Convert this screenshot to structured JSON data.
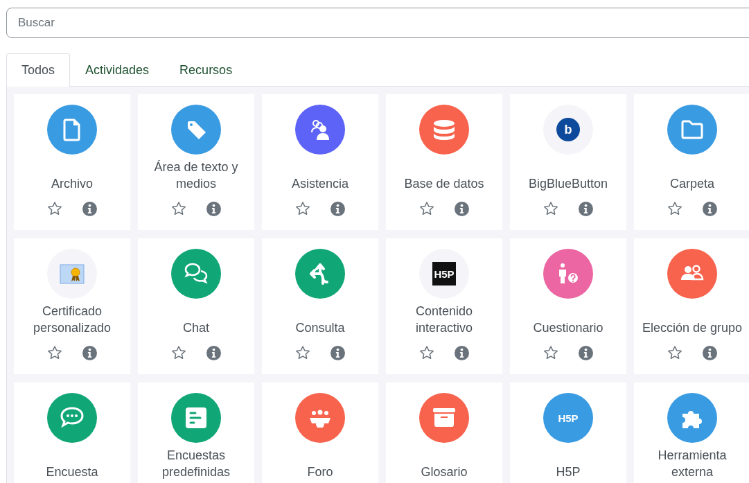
{
  "search": {
    "placeholder": "Buscar"
  },
  "tabs": [
    {
      "label": "Todos",
      "selected": true
    },
    {
      "label": "Actividades",
      "selected": false
    },
    {
      "label": "Recursos",
      "selected": false
    }
  ],
  "modules": [
    {
      "name": "Archivo",
      "kind": "file",
      "color": "#399be2",
      "starred": false
    },
    {
      "name": "Área de texto y medios",
      "kind": "tag",
      "color": "#399be2",
      "starred": false
    },
    {
      "name": "Asistencia",
      "kind": "attendance",
      "color": "#5d63f6",
      "starred": false
    },
    {
      "name": "Base de datos",
      "kind": "database",
      "color": "#f7634d",
      "starred": false
    },
    {
      "name": "BigBlueButton",
      "kind": "letter-logo",
      "icon_text": "b",
      "color": "#f5f5f9",
      "starred": false
    },
    {
      "name": "Carpeta",
      "kind": "folder",
      "color": "#399be2",
      "starred": false
    },
    {
      "name": "Certificado personalizado",
      "kind": "certificate",
      "color": "#f5f5f9",
      "starred": false
    },
    {
      "name": "Chat",
      "kind": "chat",
      "color": "#11a676",
      "starred": false
    },
    {
      "name": "Consulta",
      "kind": "split",
      "color": "#11a676",
      "starred": false
    },
    {
      "name": "Contenido interactivo",
      "kind": "h5p-dark",
      "icon_text": "H5P",
      "color": "#f5f5f9",
      "starred": false
    },
    {
      "name": "Cuestionario",
      "kind": "quiz",
      "color": "#eb66a2",
      "starred": false
    },
    {
      "name": "Elección de grupo",
      "kind": "group",
      "color": "#f7634d",
      "starred": false
    },
    {
      "name": "Encuesta",
      "kind": "survey",
      "color": "#11a676"
    },
    {
      "name": "Encuestas predefinidas",
      "kind": "feedback",
      "color": "#11a676"
    },
    {
      "name": "Foro",
      "kind": "forum",
      "color": "#f7634d"
    },
    {
      "name": "Glosario",
      "kind": "archive",
      "color": "#f7634d"
    },
    {
      "name": "H5P",
      "kind": "h5p",
      "icon_text": "H5P",
      "color": "#399be2"
    },
    {
      "name": "Herramienta externa",
      "kind": "puzzle",
      "color": "#399be2"
    }
  ]
}
